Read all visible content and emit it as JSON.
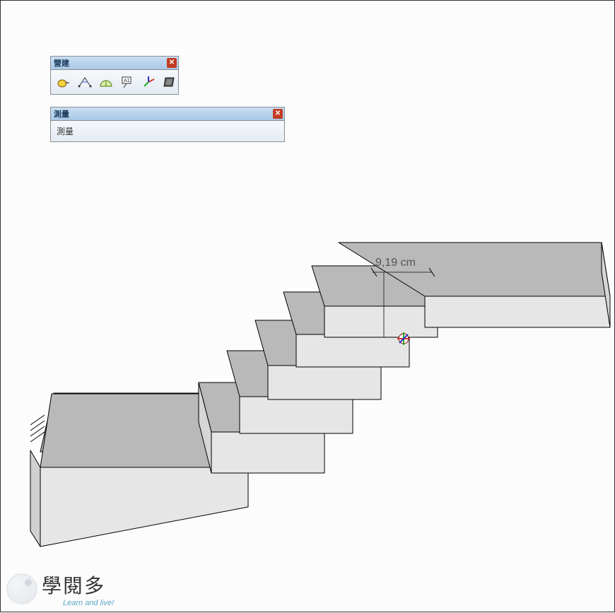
{
  "panels": {
    "construction": {
      "title": "營建",
      "tools": [
        {
          "name": "tape-measure-icon"
        },
        {
          "name": "dimension-icon"
        },
        {
          "name": "protractor-icon"
        },
        {
          "name": "text-label-icon"
        },
        {
          "name": "axes-icon"
        },
        {
          "name": "section-plane-icon"
        }
      ]
    },
    "measure": {
      "title": "測量",
      "label": "測量",
      "value": ""
    }
  },
  "dimension": {
    "text": "9,19 cm"
  },
  "watermark": {
    "title": "學閱多",
    "subtitle": "Learn and live!"
  }
}
